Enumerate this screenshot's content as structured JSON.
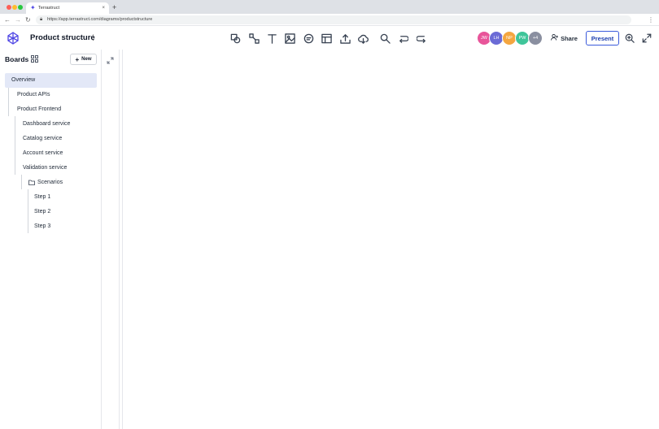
{
  "browser": {
    "tab_title": "Terrastruct",
    "tab_close": "×",
    "new_tab": "+",
    "url": "https://app.terrastruct.com/diagrams/productstructure",
    "nav_back": "←",
    "nav_forward": "→",
    "nav_reload": "↻",
    "menu": "⋮"
  },
  "header": {
    "title": "Product structure",
    "title_menu": "⋮",
    "avatars": [
      {
        "initials": "JW",
        "color": "#e8559a"
      },
      {
        "initials": "LH",
        "color": "#6b6bd6"
      },
      {
        "initials": "NP",
        "color": "#f4a640"
      },
      {
        "initials": "PW",
        "color": "#3fc59a"
      },
      {
        "initials": "+4",
        "color": "#8a8fa0"
      }
    ],
    "share_label": "Share",
    "present_label": "Present"
  },
  "toolbar": {
    "tools": [
      "shapes-icon",
      "connection-icon",
      "text-icon",
      "image-icon",
      "comment-icon",
      "layout-icon",
      "upload-icon",
      "cloud-download-icon",
      "search-icon",
      "undo-icon",
      "redo-icon"
    ]
  },
  "sidebar": {
    "title": "Boards",
    "new_label": "New",
    "new_icon": "+",
    "items": [
      {
        "label": "Overview",
        "depth": 0,
        "active": true
      },
      {
        "label": "Product APIs",
        "depth": 1,
        "active": false
      },
      {
        "label": "Product Frontend",
        "depth": 1,
        "active": false
      },
      {
        "label": "Dashboard service",
        "depth": 2,
        "active": false
      },
      {
        "label": "Catalog service",
        "depth": 2,
        "active": false
      },
      {
        "label": "Account service",
        "depth": 2,
        "active": false
      },
      {
        "label": "Validation service",
        "depth": 2,
        "active": false
      },
      {
        "label": "Scenarios",
        "depth": 3,
        "active": false,
        "folder": true
      },
      {
        "label": "Step 1",
        "depth": 4,
        "active": false
      },
      {
        "label": "Step 2",
        "depth": 4,
        "active": false
      },
      {
        "label": "Step 3",
        "depth": 4,
        "active": false
      }
    ]
  },
  "colors": {
    "accent": "#3b5bdb",
    "active_row": "#e3e8f7"
  }
}
